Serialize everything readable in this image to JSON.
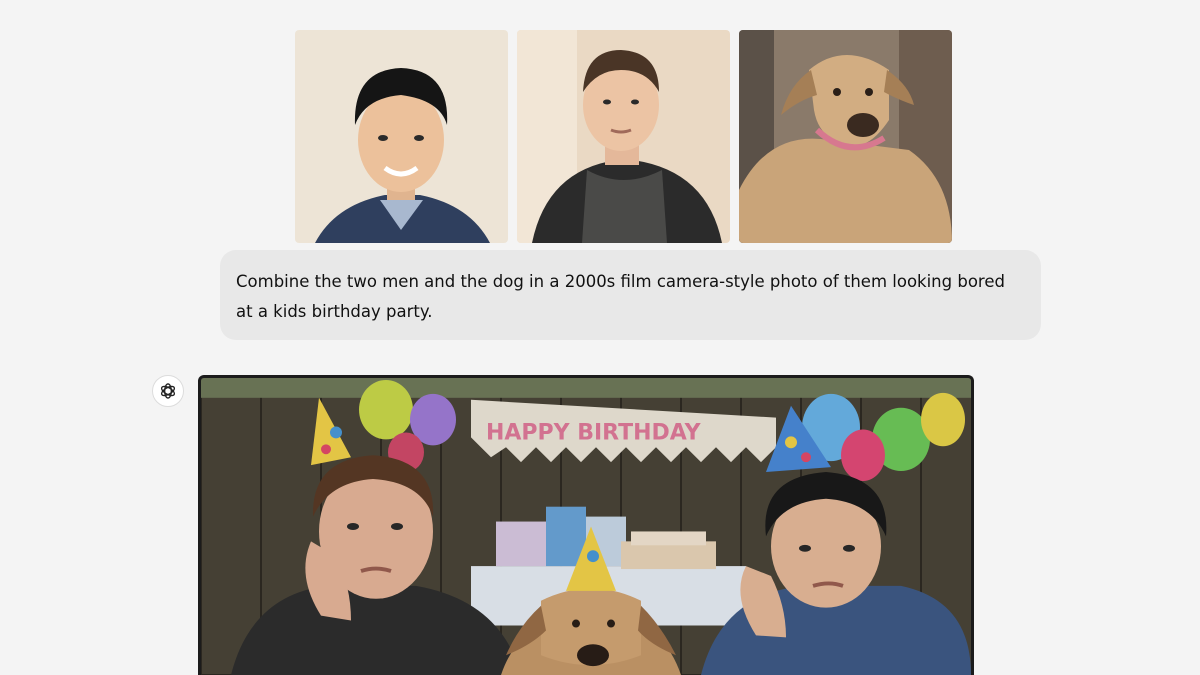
{
  "conversation": {
    "user_message": {
      "text": "Combine the two men and the dog in a 2000s film camera-style photo of them looking bored at a kids birthday party.",
      "attachments": [
        {
          "name": "attachment-man-1",
          "kind": "photo"
        },
        {
          "name": "attachment-man-2",
          "kind": "photo"
        },
        {
          "name": "attachment-dog",
          "kind": "photo"
        }
      ]
    },
    "assistant_message": {
      "avatar_icon": "openai-logo-icon",
      "image": {
        "banner_text": "HAPPY BIRTHDAY"
      }
    }
  },
  "colors": {
    "page_bg": "#f4f4f4",
    "bubble_bg": "#e8e8e8",
    "text": "#111111"
  }
}
